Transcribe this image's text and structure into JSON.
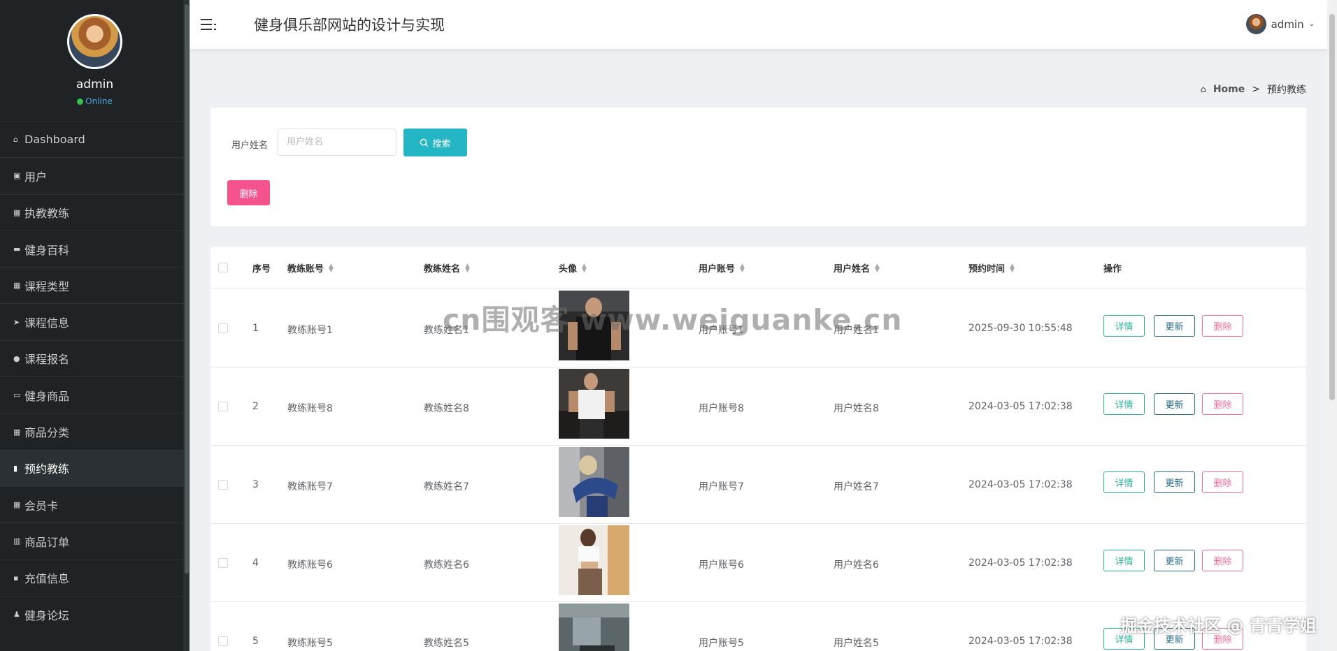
{
  "app": {
    "title": "健身俱乐部网站的设计与实现"
  },
  "profile": {
    "name": "admin",
    "status": "Online"
  },
  "header_user": {
    "name": "admin"
  },
  "sidebar": {
    "items": [
      {
        "label": "Dashboard",
        "icon": "home-icon"
      },
      {
        "label": "用户",
        "icon": "clipboard-icon"
      },
      {
        "label": "执教教练",
        "icon": "grid-icon"
      },
      {
        "label": "健身百科",
        "icon": "briefcase-icon"
      },
      {
        "label": "课程类型",
        "icon": "grid-icon"
      },
      {
        "label": "课程信息",
        "icon": "paper-plane-icon"
      },
      {
        "label": "课程报名",
        "icon": "map-pin-icon"
      },
      {
        "label": "健身商品",
        "icon": "id-card-icon"
      },
      {
        "label": "商品分类",
        "icon": "grid-icon"
      },
      {
        "label": "预约教练",
        "icon": "file-icon"
      },
      {
        "label": "会员卡",
        "icon": "table-icon"
      },
      {
        "label": "商品订单",
        "icon": "bar-chart-icon"
      },
      {
        "label": "充值信息",
        "icon": "comment-icon"
      },
      {
        "label": "健身论坛",
        "icon": "user-icon"
      }
    ]
  },
  "breadcrumb": {
    "home": "Home",
    "separator": ">",
    "current": "预约教练"
  },
  "search": {
    "label": "用户姓名",
    "placeholder": "用户姓名",
    "button": "搜索"
  },
  "actions": {
    "delete": "删除"
  },
  "table": {
    "headers": [
      "序号",
      "教练账号",
      "教练姓名",
      "头像",
      "用户账号",
      "用户姓名",
      "预约时间",
      "操作"
    ],
    "rows": [
      {
        "index": "1",
        "coach_account": "教练账号1",
        "coach_name": "教练姓名1",
        "user_account": "用户账号1",
        "user_name": "用户姓名1",
        "time": "2025-09-30 10:55:48"
      },
      {
        "index": "2",
        "coach_account": "教练账号8",
        "coach_name": "教练姓名8",
        "user_account": "用户账号8",
        "user_name": "用户姓名8",
        "time": "2024-03-05 17:02:38"
      },
      {
        "index": "3",
        "coach_account": "教练账号7",
        "coach_name": "教练姓名7",
        "user_account": "用户账号7",
        "user_name": "用户姓名7",
        "time": "2024-03-05 17:02:38"
      },
      {
        "index": "4",
        "coach_account": "教练账号6",
        "coach_name": "教练姓名6",
        "user_account": "用户账号6",
        "user_name": "用户姓名6",
        "time": "2024-03-05 17:02:38"
      },
      {
        "index": "5",
        "coach_account": "教练账号5",
        "coach_name": "教练姓名5",
        "user_account": "用户账号5",
        "user_name": "用户姓名5",
        "time": "2024-03-05 17:02:38"
      }
    ],
    "row_buttons": {
      "detail": "详情",
      "update": "更新",
      "delete": "删除"
    }
  },
  "watermarks": {
    "center": "cn围观客 www.weiguanke.cn",
    "corner": "掘金技术社区 @ 青青学姐"
  },
  "colors": {
    "sidebar_bg": "#1f2325",
    "search_btn": "#25b6c5",
    "delete_btn": "#f4538e",
    "detail": "#2bb39a",
    "update": "#246b82",
    "row_delete": "#f06b97"
  }
}
